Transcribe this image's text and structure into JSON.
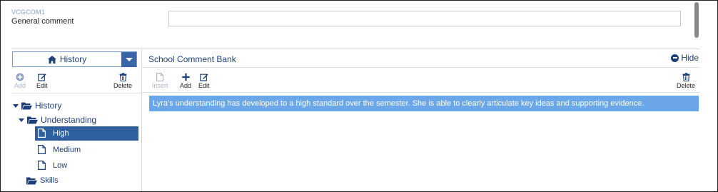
{
  "field": {
    "code": "VCGCOM1",
    "label": "General comment",
    "value": ""
  },
  "left_panel": {
    "selector_label": "History",
    "toolbar": {
      "add": "Add",
      "edit": "Edit",
      "delete": "Delete"
    },
    "tree": {
      "root": "History",
      "group": "Understanding",
      "leaves": [
        "High",
        "Medium",
        "Low"
      ],
      "selected": "High",
      "sibling_group": "Skills"
    }
  },
  "right_panel": {
    "title": "School Comment Bank",
    "hide_label": "Hide",
    "toolbar": {
      "insert": "Insert",
      "add": "Add",
      "edit": "Edit",
      "delete": "Delete"
    },
    "comments": [
      "Lyra's understanding has developed to a high standard over the semester. She is able to clearly articulate key ideas and supporting evidence."
    ]
  },
  "colors": {
    "accent": "#3a66a8",
    "selected_tree": "#2f5f9f",
    "highlight_row": "#6aa6e8",
    "text_link": "#1f3f78"
  },
  "icons": {
    "history_selector": "home-icon",
    "add": "plus-circle-icon",
    "edit": "pencil-square-icon",
    "delete": "trash-icon",
    "insert": "document-icon",
    "folder": "folder-open-icon",
    "leaf": "document-icon",
    "hide": "minus-circle-icon"
  }
}
